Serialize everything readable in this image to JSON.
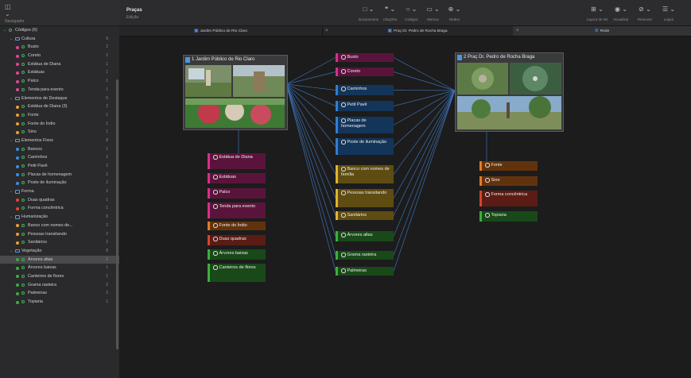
{
  "sidebar": {
    "nav_label": "Navegador",
    "root": {
      "label": "Códigos (6)"
    },
    "groups": [
      {
        "label": "Cultura",
        "count": "9",
        "items": [
          {
            "label": "Busto",
            "count": "2"
          },
          {
            "label": "Coreto",
            "count": "2"
          },
          {
            "label": "Estátua de Diana",
            "count": "1"
          },
          {
            "label": "Estátuas",
            "count": "1"
          },
          {
            "label": "Palco",
            "count": "1"
          },
          {
            "label": "Tenda para evento",
            "count": "1"
          }
        ]
      },
      {
        "label": "Elementos de Destaque",
        "count": "5",
        "items": [
          {
            "label": "Estátua de Diana (3)",
            "count": "2"
          },
          {
            "label": "Fonte",
            "count": "1"
          },
          {
            "label": "Fonte do Índio",
            "count": "1"
          },
          {
            "label": "Sino",
            "count": "1"
          }
        ]
      },
      {
        "label": "Elementos Fixos",
        "count": "8",
        "items": [
          {
            "label": "Bancos",
            "count": "1"
          },
          {
            "label": "Caminhos",
            "count": "2"
          },
          {
            "label": "Petit Pavê",
            "count": "2"
          },
          {
            "label": "Placas de homenagem",
            "count": "2"
          },
          {
            "label": "Poste de iluminação",
            "count": "2"
          }
        ]
      },
      {
        "label": "Forma",
        "count": "2",
        "items": [
          {
            "label": "Duas quadras",
            "count": "1"
          },
          {
            "label": "Forma concêntrica",
            "count": "1"
          }
        ]
      },
      {
        "label": "Humanização",
        "count": "6",
        "items": [
          {
            "label": "Banco com nomes de...",
            "count": "2"
          },
          {
            "label": "Pessoas transitando",
            "count": "2"
          },
          {
            "label": "Sanitários",
            "count": "2"
          }
        ]
      },
      {
        "label": "Vegetação",
        "count": "8",
        "items": [
          {
            "label": "Árvores altas",
            "count": "2"
          },
          {
            "label": "Árvores baixas",
            "count": "1"
          },
          {
            "label": "Canteiros de flores",
            "count": "1"
          },
          {
            "label": "Grama rasteira",
            "count": "2"
          },
          {
            "label": "Palmeiras",
            "count": "2"
          },
          {
            "label": "Topiaria",
            "count": "1"
          }
        ]
      }
    ]
  },
  "toolbar": {
    "title": "Praças",
    "subtitle": "Edição",
    "groups": [
      {
        "icon": "document-icon",
        "label": "Documentos"
      },
      {
        "icon": "quote-icon",
        "label": "Citações"
      },
      {
        "icon": "code-icon",
        "label": "Códigos"
      },
      {
        "icon": "memo-icon",
        "label": "Memos"
      },
      {
        "icon": "network-icon",
        "label": "Redes"
      }
    ],
    "right_groups": [
      {
        "icon": "layout-icon",
        "label": "Layout de Nó"
      },
      {
        "icon": "eye-icon",
        "label": "Visualizar"
      },
      {
        "icon": "remove-icon",
        "label": "Remover"
      },
      {
        "icon": "legend-icon",
        "label": "Legen"
      }
    ]
  },
  "tabs": [
    {
      "label": "Jardim Público de Rio Claro"
    },
    {
      "label": "Praç Dr. Pedro de Rocha Braga"
    },
    {
      "label": "Rede"
    }
  ],
  "network": {
    "doc1": {
      "title": "1 Jardim Público de Rio Claro"
    },
    "doc2": {
      "title": "2 Praç Dr. Pedro de Rocha Braga"
    },
    "codes_center": [
      {
        "label": "Busto",
        "color": "#d62f8c"
      },
      {
        "label": "Coreto",
        "color": "#d62f8c"
      },
      {
        "label": "Caminhos",
        "color": "#2f7fd6"
      },
      {
        "label": "Petit Pavê",
        "color": "#2f7fd6"
      },
      {
        "label": "Placas de homenagem",
        "color": "#2f7fd6"
      },
      {
        "label": "Poste de iluminação",
        "color": "#2f7fd6"
      },
      {
        "label": "Banco com nomes de família",
        "color": "#e0b52a"
      },
      {
        "label": "Pessoas transitando",
        "color": "#e0b52a"
      },
      {
        "label": "Sanitários",
        "color": "#e0b52a"
      },
      {
        "label": "Árvores altas",
        "color": "#3cae3c"
      },
      {
        "label": "Grama rasteira",
        "color": "#3cae3c"
      },
      {
        "label": "Palmeiras",
        "color": "#3cae3c"
      }
    ],
    "codes_left": [
      {
        "label": "Estátua de Diana",
        "color": "#d62f8c"
      },
      {
        "label": "Estátuas",
        "color": "#d62f8c"
      },
      {
        "label": "Palco",
        "color": "#d62f8c"
      },
      {
        "label": "Tenda para evento",
        "color": "#d62f8c"
      },
      {
        "label": "Fonte do Índio",
        "color": "#e87a1e"
      },
      {
        "label": "Duas quadras",
        "color": "#d6432f"
      },
      {
        "label": "Árvores baixas",
        "color": "#3cae3c"
      },
      {
        "label": "Canteiros de flores",
        "color": "#3cae3c"
      }
    ],
    "codes_right": [
      {
        "label": "Fonte",
        "color": "#e87a1e"
      },
      {
        "label": "Sino",
        "color": "#e87a1e"
      },
      {
        "label": "Forma concêntrica",
        "color": "#d6432f"
      },
      {
        "label": "Topiaria",
        "color": "#3cae3c"
      }
    ]
  }
}
